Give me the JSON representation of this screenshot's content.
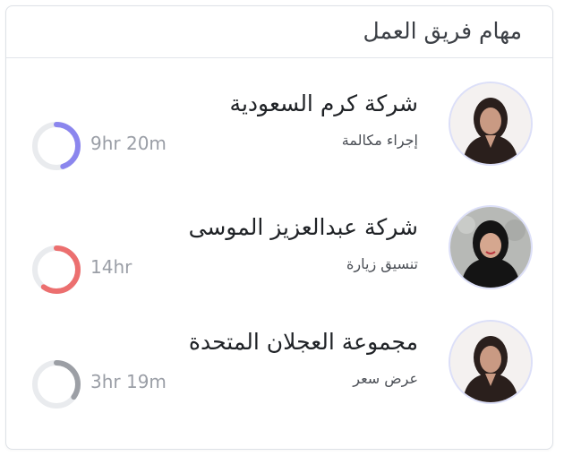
{
  "header": {
    "title": "مهام فريق العمل"
  },
  "tasks": [
    {
      "company": "شركة كرم السعودية",
      "task_type": "إجراء مكالمة",
      "duration": "9hr 20m",
      "ring_color": "#8b86ee",
      "ring_progress": 0.45,
      "avatar_icon": "person-avatar-icon",
      "avatar_bg": "#f4f1f0"
    },
    {
      "company": "شركة عبدالعزيز الموسى",
      "task_type": "تنسيق زيارة",
      "duration": "14hr",
      "ring_color": "#ec6f6f",
      "ring_progress": 0.6,
      "avatar_icon": "person-avatar-icon",
      "avatar_bg": "#b7b9b6"
    },
    {
      "company": "مجموعة العجلان المتحدة",
      "task_type": "عرض سعر",
      "duration": "3hr 19m",
      "ring_color": "#9c9fa5",
      "ring_progress": 0.35,
      "avatar_icon": "person-avatar-icon",
      "avatar_bg": "#f4f1f0"
    }
  ],
  "colors": {
    "ring_track": "#e9ebee",
    "title_text": "#3b3f45",
    "duration_text": "#9a9ea6"
  }
}
